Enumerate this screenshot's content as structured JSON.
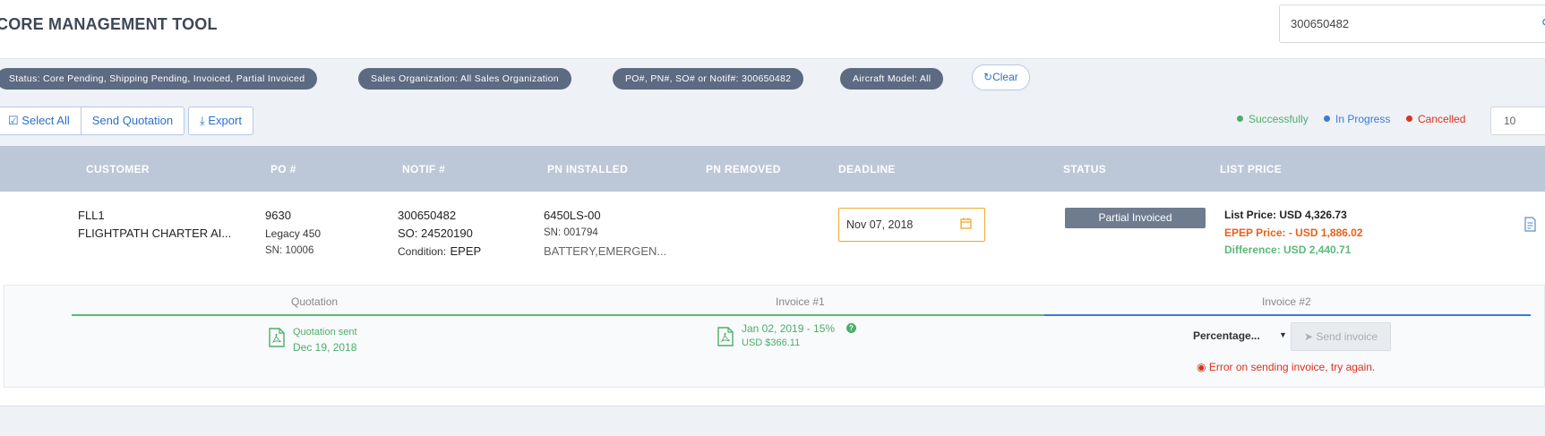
{
  "header": {
    "app_title": "CORE MANAGEMENT TOOL",
    "search_value": "300650482"
  },
  "filters": {
    "chips": [
      "Status: Core Pending, Shipping Pending, Invoiced, Partial Invoiced",
      "Sales Organization: All Sales Organization",
      "PO#, PN#, SO# or Notif#: 300650482",
      "Aircraft Model: All"
    ],
    "clear_label": "Clear"
  },
  "toolbar": {
    "select_all_label": "Select All",
    "send_quotation_label": "Send Quotation",
    "export_label": "Export",
    "legend": [
      {
        "label": "Successfully",
        "color": "#4cae6a"
      },
      {
        "label": "In Progress",
        "color": "#3b7bd4"
      },
      {
        "label": "Cancelled",
        "color": "#d9321f"
      }
    ],
    "page_size": "10"
  },
  "table": {
    "columns": [
      "CUSTOMER",
      "PO #",
      "NOTIF #",
      "PN INSTALLED",
      "PN REMOVED",
      "DEADLINE",
      "STATUS",
      "LIST PRICE"
    ],
    "row": {
      "customer_code": "FLL1",
      "customer_name": "FLIGHTPATH CHARTER AI...",
      "po_number": "9630",
      "aircraft": "Legacy 450",
      "aircraft_sn": "SN: 10006",
      "notif_number": "300650482",
      "so_number": "SO: 24520190",
      "condition_label": "Condition:",
      "condition_value": "EPEP",
      "pn_installed": "6450LS-00",
      "pn_installed_sn": "SN: 001794",
      "pn_installed_desc": "BATTERY,EMERGEN...",
      "deadline": "Nov 07, 2018",
      "status": "Partial Invoiced",
      "list_price_label": "List Price:",
      "list_price_value": "USD 4,326.73",
      "epep_price": "EPEP Price: - USD 1,886.02",
      "difference": "Difference: USD 2,440.71"
    }
  },
  "workflow": {
    "steps": [
      "Quotation",
      "Invoice #1",
      "Invoice #2"
    ],
    "quotation_status": "Quotation sent",
    "quotation_date": "Dec 19, 2018",
    "invoice1_line": "Jan 02, 2019 - 15%",
    "invoice1_amount": "USD $366.11",
    "percentage_select": "Percentage...",
    "send_invoice_label": "Send invoice",
    "error_message": "Error on sending invoice, try again."
  }
}
